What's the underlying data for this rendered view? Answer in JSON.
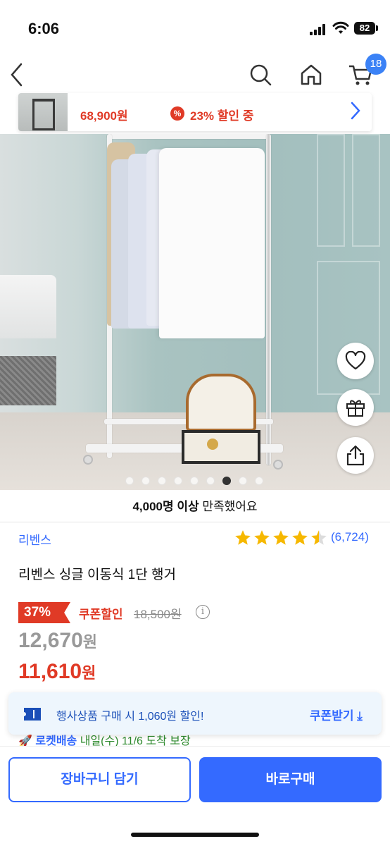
{
  "status_bar": {
    "time": "6:06",
    "battery": "82"
  },
  "nav": {
    "back_icon": "chevron-left-icon",
    "search_icon": "search-icon",
    "home_icon": "home-icon",
    "cart_icon": "cart-icon",
    "cart_count": "18"
  },
  "mini_banner": {
    "price": "68,900원",
    "discount_symbol": "%",
    "discount_text": "23% 할인 중"
  },
  "gallery": {
    "total_slides": 9,
    "active_slide": 7
  },
  "floating": {
    "wishlist_icon": "heart-icon",
    "gift_icon": "gift-icon",
    "share_icon": "share-icon"
  },
  "product": {
    "satisfaction_bold": "4,000명 이상",
    "satisfaction_rest": " 만족했어요",
    "brand": "리벤스",
    "rating": 4.5,
    "review_count": "(6,724)",
    "title": "리벤스 싱글 이동식 1단 행거",
    "discount_badge": "37%",
    "coupon_label": "쿠폰할인",
    "original_price": "18,500원",
    "info_symbol": "i",
    "price": "12,670",
    "price_unit": "원",
    "coupon_price": "11,610",
    "coupon_price_unit": "원"
  },
  "delivery": {
    "badge": "로켓배송",
    "date": "내일(수) 11/6 도착 보장"
  },
  "coupon_toast": {
    "text": "행사상품 구매 시 1,060원 할인!",
    "action": "쿠폰받기 ⤓"
  },
  "bottom_bar": {
    "cart_button": "장바구니 담기",
    "buy_button": "바로구매"
  },
  "colors": {
    "accent": "#346aff",
    "sale": "#e03a26",
    "badge": "#3b82f6"
  }
}
